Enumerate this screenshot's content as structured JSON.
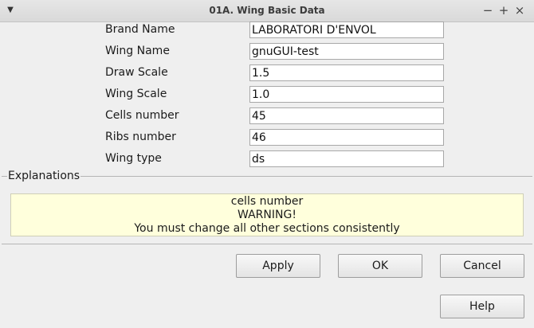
{
  "window": {
    "title": "01A. Wing Basic Data",
    "minimize_glyph": "−",
    "maximize_glyph": "+",
    "close_glyph": "×",
    "menu_glyph": "▼"
  },
  "form": {
    "fields": [
      {
        "label": "Brand Name",
        "value": "LABORATORI D'ENVOL"
      },
      {
        "label": "Wing Name",
        "value": "gnuGUI-test"
      },
      {
        "label": "Draw Scale",
        "value": "1.5"
      },
      {
        "label": "Wing Scale",
        "value": "1.0"
      },
      {
        "label": "Cells number",
        "value": "45"
      },
      {
        "label": "Ribs number",
        "value": "46"
      },
      {
        "label": "Wing type",
        "value": "ds"
      }
    ]
  },
  "explanations": {
    "title": "Explanations",
    "lines": [
      "cells number",
      "WARNING!",
      "You must change all other sections consistently"
    ]
  },
  "buttons": {
    "apply": "Apply",
    "ok": "OK",
    "cancel": "Cancel",
    "help": "Help"
  }
}
